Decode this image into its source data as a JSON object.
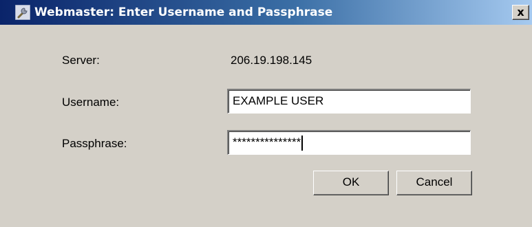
{
  "window": {
    "title": "Webmaster: Enter Username and Passphrase",
    "icon": "wrench-icon",
    "close_label": "x"
  },
  "form": {
    "server_label": "Server:",
    "server_value": "206.19.198.145",
    "username_label": "Username:",
    "username_value": "EXAMPLE USER",
    "passphrase_label": "Passphrase:",
    "passphrase_value": "***************"
  },
  "buttons": {
    "ok_label": "OK",
    "cancel_label": "Cancel"
  },
  "colors": {
    "titlebar_start": "#0a246a",
    "titlebar_end": "#a6caf0",
    "dialog_background": "#d4d0c8"
  }
}
